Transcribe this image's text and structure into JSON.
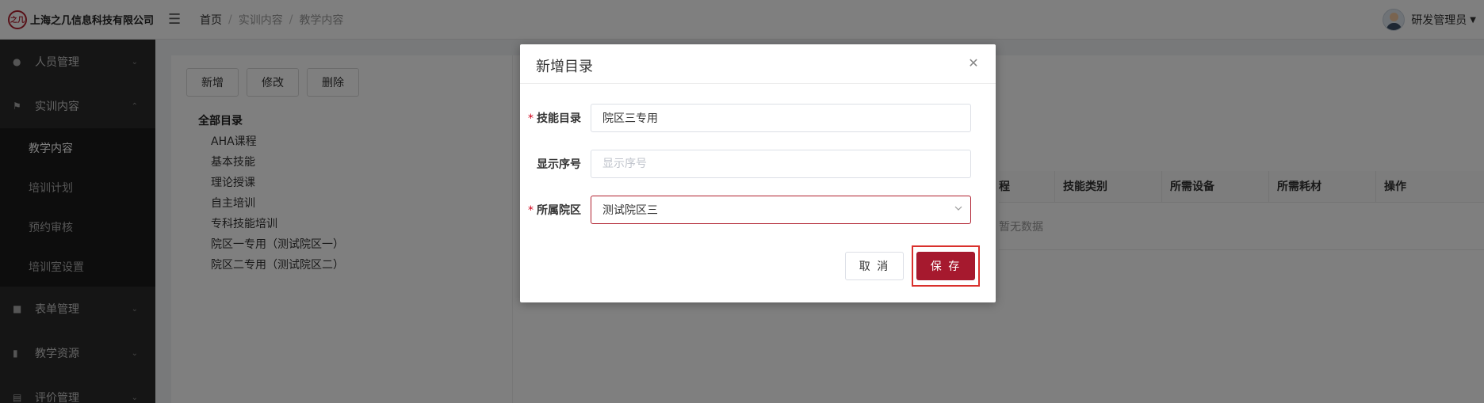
{
  "app": {
    "company_name": "上海之几信息科技有限公司",
    "logo_text": "之几"
  },
  "breadcrumb": [
    "首页",
    "实训内容",
    "教学内容"
  ],
  "user": {
    "name": "研发管理员"
  },
  "sidebar": {
    "groups": [
      {
        "label": "人员管理",
        "icon": "person-icon"
      },
      {
        "label": "实训内容",
        "icon": "flag-icon",
        "expanded": true,
        "items": [
          "教学内容",
          "培训计划",
          "预约审核",
          "培训室设置"
        ],
        "active": "教学内容"
      },
      {
        "label": "表单管理",
        "icon": "form-icon"
      },
      {
        "label": "教学资源",
        "icon": "book-icon"
      },
      {
        "label": "评价管理",
        "icon": "evaluate-icon"
      }
    ]
  },
  "toolbar": {
    "add_label": "新增",
    "edit_label": "修改",
    "delete_label": "删除"
  },
  "tree": {
    "root": "全部目录",
    "nodes": [
      "AHA课程",
      "基本技能",
      "理论授课",
      "自主培训",
      "专科技能培训",
      "院区一专用（测试院区一）",
      "院区二专用（测试院区二）"
    ]
  },
  "table": {
    "partial_header": "程",
    "headers": [
      "技能类别",
      "所需设备",
      "所需耗材",
      "操作"
    ],
    "empty_text": "暂无数据"
  },
  "modal": {
    "title": "新增目录",
    "fields": {
      "skill_dir": {
        "label": "技能目录",
        "value": "院区三专用",
        "required": true
      },
      "display_order": {
        "label": "显示序号",
        "placeholder": "显示序号",
        "value": ""
      },
      "campus": {
        "label": "所属院区",
        "value": "测试院区三",
        "required": true
      }
    },
    "cancel_label": "取 消",
    "save_label": "保 存"
  },
  "colors": {
    "brand": "#a6192e",
    "sidebar_bg": "#2b2b2b",
    "highlight_box": "#d9302c"
  }
}
